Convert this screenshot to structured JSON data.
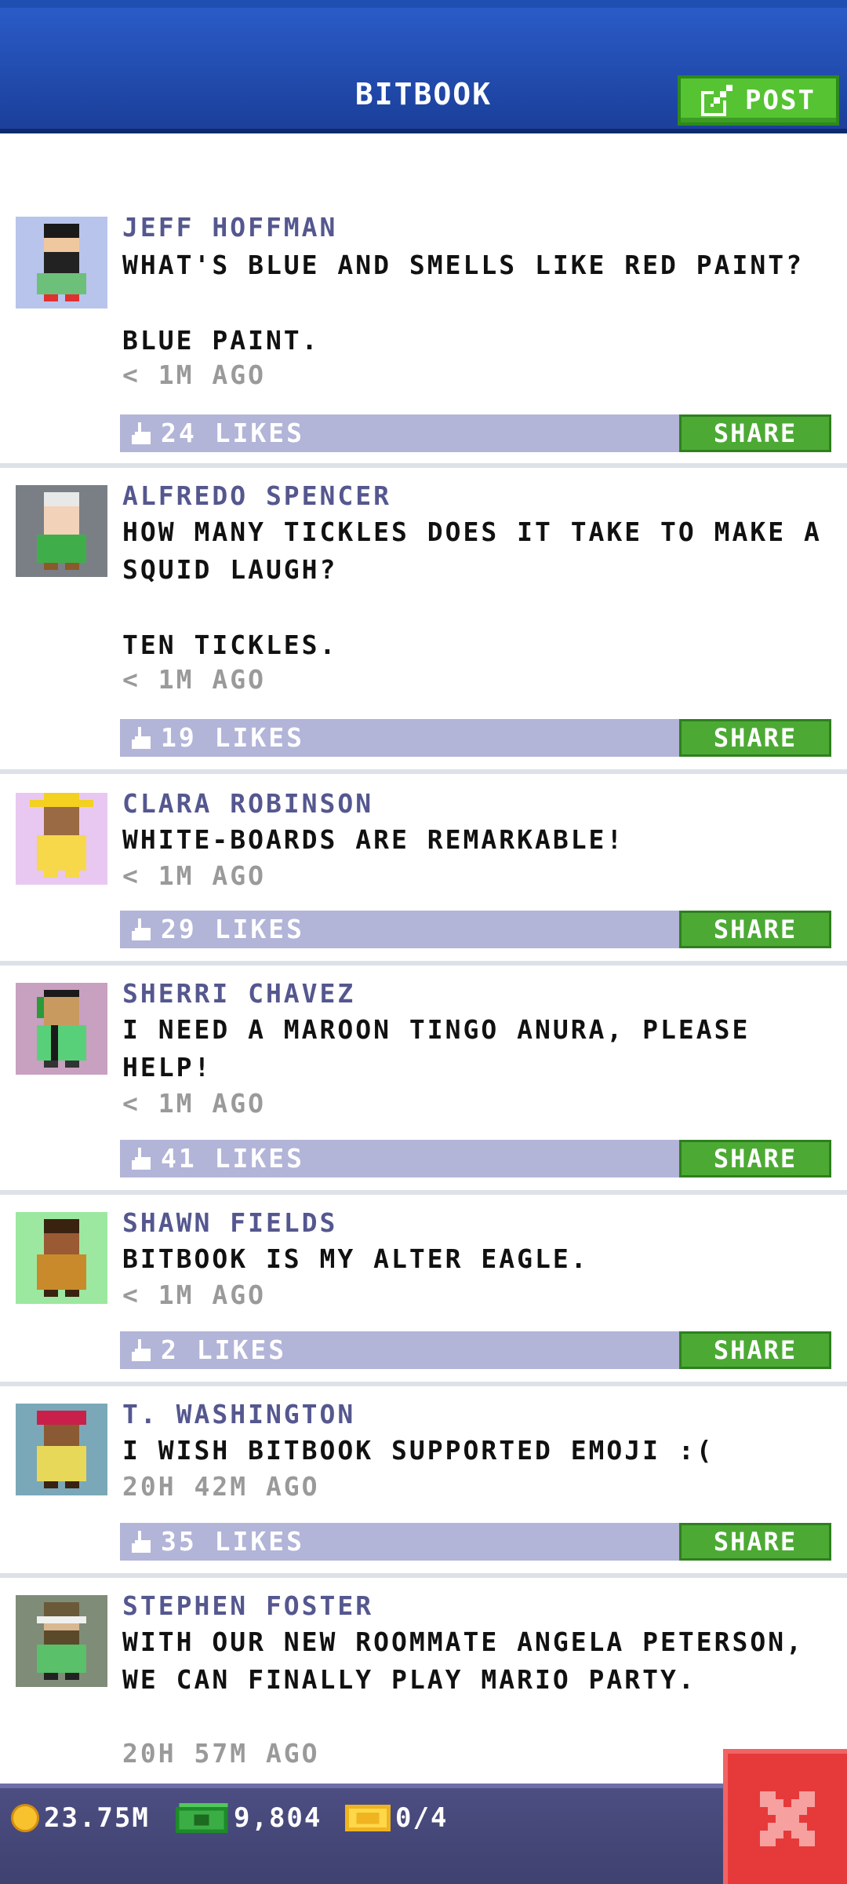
{
  "header": {
    "title": "BITBOOK",
    "post_label": "POST"
  },
  "posts": [
    {
      "author": "JEFF HOFFMAN",
      "text": "WHAT'S BLUE AND SMELLS LIKE RED PAINT?\n\nBLUE PAINT.",
      "time": "< 1M AGO",
      "likes": "24 LIKES",
      "share": "SHARE",
      "avatar_bg": "#b8c4ec"
    },
    {
      "author": "ALFREDO SPENCER",
      "text": "HOW MANY TICKLES DOES IT TAKE TO MAKE A SQUID LAUGH?\n\nTEN TICKLES.",
      "time": "< 1M AGO",
      "likes": "19 LIKES",
      "share": "SHARE",
      "avatar_bg": "#7a7f86"
    },
    {
      "author": "CLARA ROBINSON",
      "text": "WHITE-BOARDS ARE REMARKABLE!",
      "time": "< 1M AGO",
      "likes": "29 LIKES",
      "share": "SHARE",
      "avatar_bg": "#e8c8f0"
    },
    {
      "author": "SHERRI CHAVEZ",
      "text": "I NEED A MAROON TINGO ANURA, PLEASE HELP!",
      "time": "< 1M AGO",
      "likes": "41 LIKES",
      "share": "SHARE",
      "avatar_bg": "#c8a0c0"
    },
    {
      "author": "SHAWN FIELDS",
      "text": "BITBOOK IS MY ALTER EAGLE.",
      "time": "< 1M AGO",
      "likes": "2 LIKES",
      "share": "SHARE",
      "avatar_bg": "#9ce8a0"
    },
    {
      "author": "T. WASHINGTON",
      "text": "I WISH BITBOOK SUPPORTED EMOJI :(",
      "time": "20H 42M AGO",
      "likes": "35 LIKES",
      "share": "SHARE",
      "avatar_bg": "#7aa8b8"
    },
    {
      "author": "STEPHEN FOSTER",
      "text": "WITH OUR NEW ROOMMATE ANGELA PETERSON, WE CAN FINALLY PLAY MARIO PARTY.",
      "time": "20H 57M AGO",
      "likes": "",
      "share": "",
      "avatar_bg": "#7f8c78"
    }
  ],
  "status": {
    "coins": "23.75M",
    "cash": "9,804",
    "tickets": "0/4"
  },
  "icons": {
    "post": "edit-icon",
    "like": "thumbs-up-icon",
    "coin": "coin-icon",
    "cash": "cash-icon",
    "ticket": "ticket-icon",
    "close": "close-icon"
  },
  "colors": {
    "header": "#1b3f9a",
    "accent_green": "#4caa34",
    "likes_bar": "#b2b4d8",
    "author": "#55578f",
    "close": "#e63a3a"
  }
}
